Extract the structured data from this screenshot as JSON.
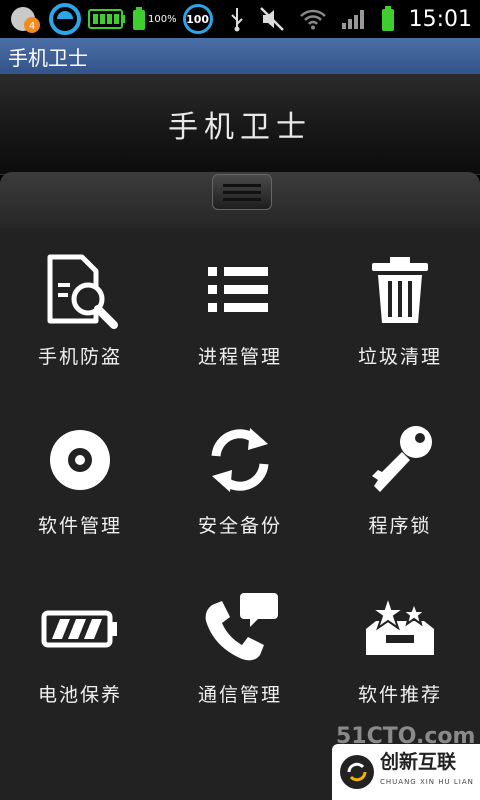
{
  "status_bar": {
    "battery_percent_label": "100%",
    "circle_badge": "100",
    "time": "15:01",
    "notification_count": "4"
  },
  "app": {
    "window_title": "手机卫士",
    "header_title": "手机卫士"
  },
  "menu": [
    {
      "label": "手机防盗",
      "icon": "document-search-icon"
    },
    {
      "label": "进程管理",
      "icon": "list-icon"
    },
    {
      "label": "垃圾清理",
      "icon": "trash-icon"
    },
    {
      "label": "软件管理",
      "icon": "disc-icon"
    },
    {
      "label": "安全备份",
      "icon": "sync-icon"
    },
    {
      "label": "程序锁",
      "icon": "key-icon"
    },
    {
      "label": "电池保养",
      "icon": "battery-icon"
    },
    {
      "label": "通信管理",
      "icon": "phone-chat-icon"
    },
    {
      "label": "软件推荐",
      "icon": "star-box-icon"
    }
  ],
  "watermark": {
    "site": "51CTO.com",
    "brand": "创新互联",
    "brand_sub": "CHUANG XIN HU LIAN"
  },
  "colors": {
    "title_bar": "#3f6399",
    "grid_bg": "#222222",
    "accent_blue": "#2aa7e8",
    "battery_green": "#3ecf2f"
  }
}
